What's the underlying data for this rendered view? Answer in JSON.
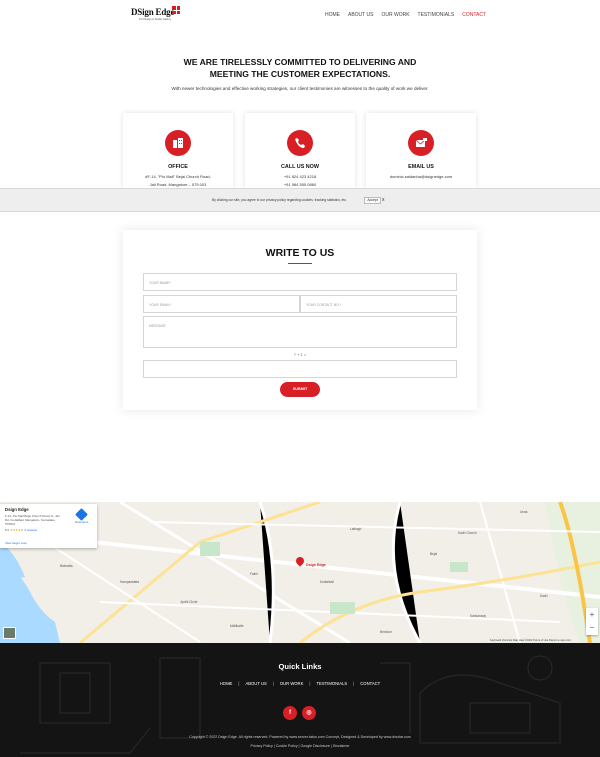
{
  "header": {
    "logo_main": "DSign Edge",
    "logo_tagline": "Pvt Design & Studio Gallery",
    "nav": [
      "HOME",
      "ABOUT US",
      "OUR WORK",
      "TESTIMONIALS",
      "CONTACT"
    ],
    "active_nav": "CONTACT"
  },
  "hero": {
    "line1": "WE ARE TIRELESSLY COMMITTED TO DELIVERING AND",
    "line2": "MEETING THE CUSTOMER EXPECTATIONS.",
    "subtitle": "With newer technologies and effective working strategies, our client testimonies are witnesses to the quality of work we deliver."
  },
  "cards": [
    {
      "title": "OFFICE",
      "line1": "#F-14, \"Pio Mall\" Bejai Church Road,",
      "line2": "Jail Road, Mangalore – 575 003",
      "icon": "building-icon"
    },
    {
      "title": "CALL US NOW",
      "line1": "+91 824 423 4218",
      "line2": "+91 984 555 0860",
      "icon": "phone-icon"
    },
    {
      "title": "EMAIL US",
      "line1": "dominic.saldanha@dsignedge.com",
      "line2": "",
      "icon": "email-icon"
    }
  ],
  "cookie": {
    "text": "By clicking our site, you agree to our privacy policy regarding cookies, tracking statistics, etc.",
    "accept": "Accept",
    "close": "x"
  },
  "form": {
    "title": "WRITE TO US",
    "name_placeholder": "YOUR NAME*",
    "email_placeholder": "YOUR EMAIL*",
    "contact_placeholder": "YOUR CONTACT NO.*",
    "message_placeholder": "MESSAGE",
    "captcha": "7 + 1 =",
    "submit": "SUBMIT"
  },
  "map": {
    "place_name": "Dsign Edge",
    "address": "F-14, Pio Mall Bejai Church Road, N, Jail Rd, Kodialbail, Mangaluru, Karnataka 575003",
    "rating": "5.0",
    "stars": "★★★★★",
    "reviews": "6 reviews",
    "view_larger": "View larger map",
    "directions": "Directions",
    "pin_label": "Dsign Edge",
    "zoom_in": "+",
    "zoom_out": "−",
    "footer_text": "Keyboard shortcuts   Map data ©2022   Terms of Use   Report a map error",
    "labels": [
      "Kadri Church",
      "Jyothi Circle",
      "Lalbagh",
      "Bejai",
      "Kodialbail",
      "Hampankatta",
      "Mallikatte",
      "Kadri",
      "Kankanady",
      "Falnir",
      "Bendoor",
      "Balmatta",
      "Urwa"
    ]
  },
  "footer": {
    "title": "Quick Links",
    "links": [
      "HOME",
      "ABOUT US",
      "OUR WORK",
      "TESTIMONIALS",
      "CONTACT"
    ],
    "social": [
      {
        "label": "f",
        "icon": "facebook-icon"
      },
      {
        "label": "◎",
        "icon": "instagram-icon"
      }
    ],
    "copyright": "Copyright © 2022 Dsign Edge. All rights reserved. Powered by www.server-tatus.com Concept, Designed & Developed by www.drsolar.com",
    "policies": "Privacy Policy | Cookie Policy | Google Disclosure | Disclaimer"
  },
  "colors": {
    "accent": "#d81f26",
    "footer_bg": "#141414",
    "map_bg": "#f2efe9"
  }
}
